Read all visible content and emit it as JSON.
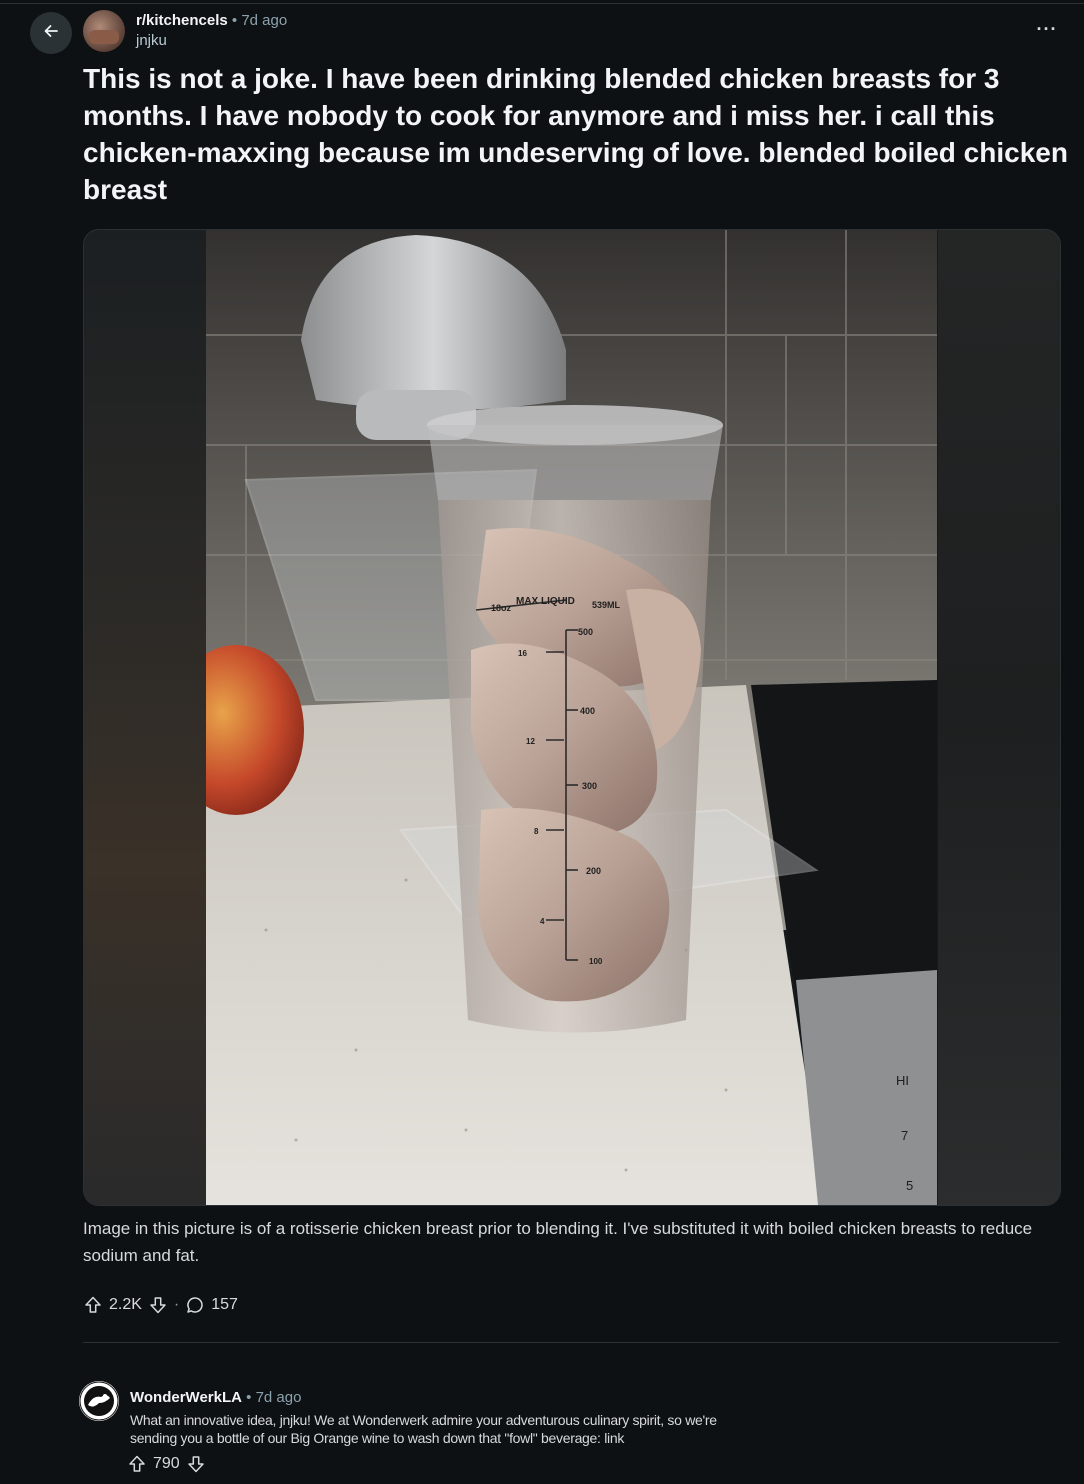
{
  "post": {
    "subreddit": "r/kitchencels",
    "separator": "•",
    "age": "7d ago",
    "author": "jnjku",
    "more_label": "···",
    "title": "This is not a joke. I have been drinking blended chicken breasts for 3 months. I have nobody to cook for anymore and i miss her. i call this chicken-maxxing because im undeserving of love. blended boiled chicken breast",
    "caption": "Image in this picture is of a rotisserie chicken breast prior to blending it. I've substituted it with boiled chicken breasts to reduce sodium and fat.",
    "upvotes": "2.2K",
    "separator2": "·",
    "comments": "157",
    "image": {
      "cup_labels": {
        "max_liquid": "MAX LIQUID",
        "oz_max": "18oz",
        "ml_max": "539ML",
        "ml_500": "500",
        "ml_400": "400",
        "ml_300": "300",
        "ml_200": "200",
        "ml_100": "100",
        "oz_16": "16",
        "oz_12": "12",
        "oz_8": "8",
        "oz_4": "4"
      },
      "stove_labels": {
        "hi": "HI",
        "seven": "7",
        "five": "5"
      }
    }
  },
  "comment": {
    "author": "WonderWerkLA",
    "separator": "•",
    "age": "7d ago",
    "body": "What an innovative idea, jnjku! We at Wonderwerk admire your adventurous culinary spirit, so we're sending you a bottle of our Big Orange wine to wash down that \"fowl\" beverage: link",
    "upvotes": "790"
  },
  "icons": {
    "back": "arrow-left-icon",
    "upvote": "arrow-up-icon",
    "downvote": "arrow-down-icon",
    "comment": "speech-bubble-icon",
    "more": "ellipsis-icon"
  }
}
